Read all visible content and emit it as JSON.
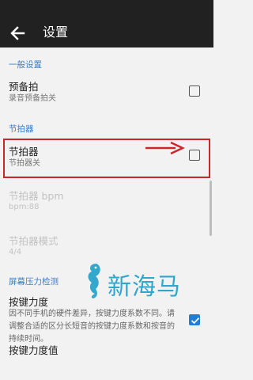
{
  "app_bar": {
    "title": "设置"
  },
  "sections": {
    "general_header": "一般设置",
    "metronome_header": "节拍器",
    "pressure_header": "屏幕压力检测"
  },
  "preferences": {
    "pre_count": {
      "title": "预备拍",
      "summary": "录音预备拍关",
      "checked": false
    },
    "metronome": {
      "title": "节拍器",
      "summary": "节拍器关",
      "checked": false
    },
    "metronome_bpm": {
      "title": "节拍器 bpm",
      "summary": "bpm:88"
    },
    "metronome_mode": {
      "title": "节拍器模式",
      "summary": "4/4"
    },
    "key_velocity": {
      "title": "按键力度",
      "summary": "因不同手机的硬件差异，按键力度系数不同。请调整合适的区分长短音的按键力度系数和按音的持续时间。",
      "checked": true
    },
    "key_velocity_value": {
      "title": "按键力度值"
    }
  },
  "watermark": {
    "text": "新海马"
  },
  "colors": {
    "accent": "#1e7fd6",
    "highlight": "#c9282a",
    "app_bar": "#212121"
  }
}
